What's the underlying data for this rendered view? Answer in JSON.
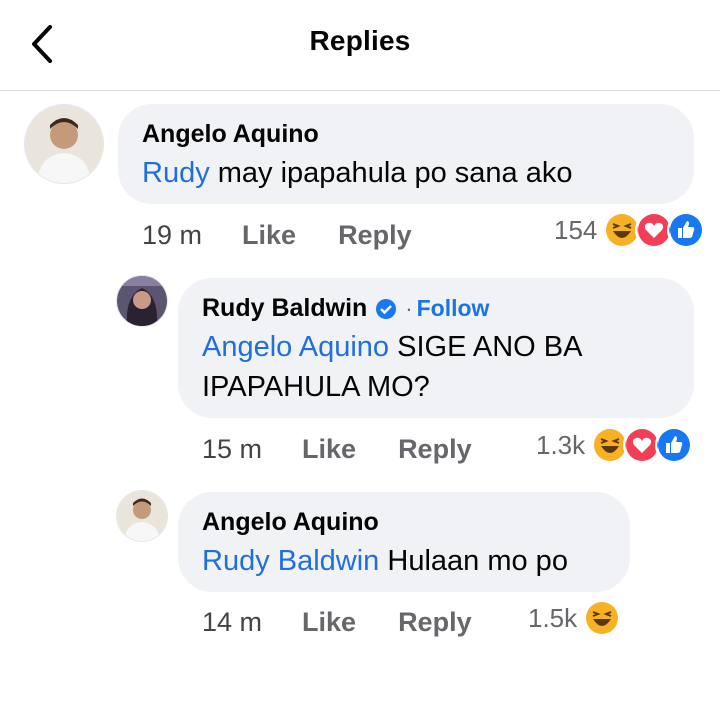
{
  "header": {
    "title": "Replies"
  },
  "comments": [
    {
      "author": "Angelo Aquino",
      "mention": "Rudy",
      "text": " may ipapahula po sana ako",
      "time": "19 m",
      "like": "Like",
      "reply": "Reply",
      "reaction_count": "154",
      "reactions": [
        "haha",
        "love",
        "like"
      ]
    },
    {
      "author": "Rudy Baldwin",
      "verified": true,
      "follow_separator": "·",
      "follow": "Follow",
      "mention": "Angelo Aquino",
      "text": " SIGE ANO BA IPAPAHULA MO?",
      "time": "15 m",
      "like": "Like",
      "reply": "Reply",
      "reaction_count": "1.3k",
      "reactions": [
        "haha",
        "love",
        "like"
      ]
    },
    {
      "author": "Angelo Aquino",
      "mention": "Rudy Baldwin",
      "text": " Hulaan mo po",
      "time": "14 m",
      "like": "Like",
      "reply": "Reply",
      "reaction_count": "1.5k",
      "reactions": [
        "haha"
      ]
    }
  ],
  "colors": {
    "mention": "#216fdb",
    "bubble": "#f0f2f5",
    "follow": "#1b74e4"
  }
}
